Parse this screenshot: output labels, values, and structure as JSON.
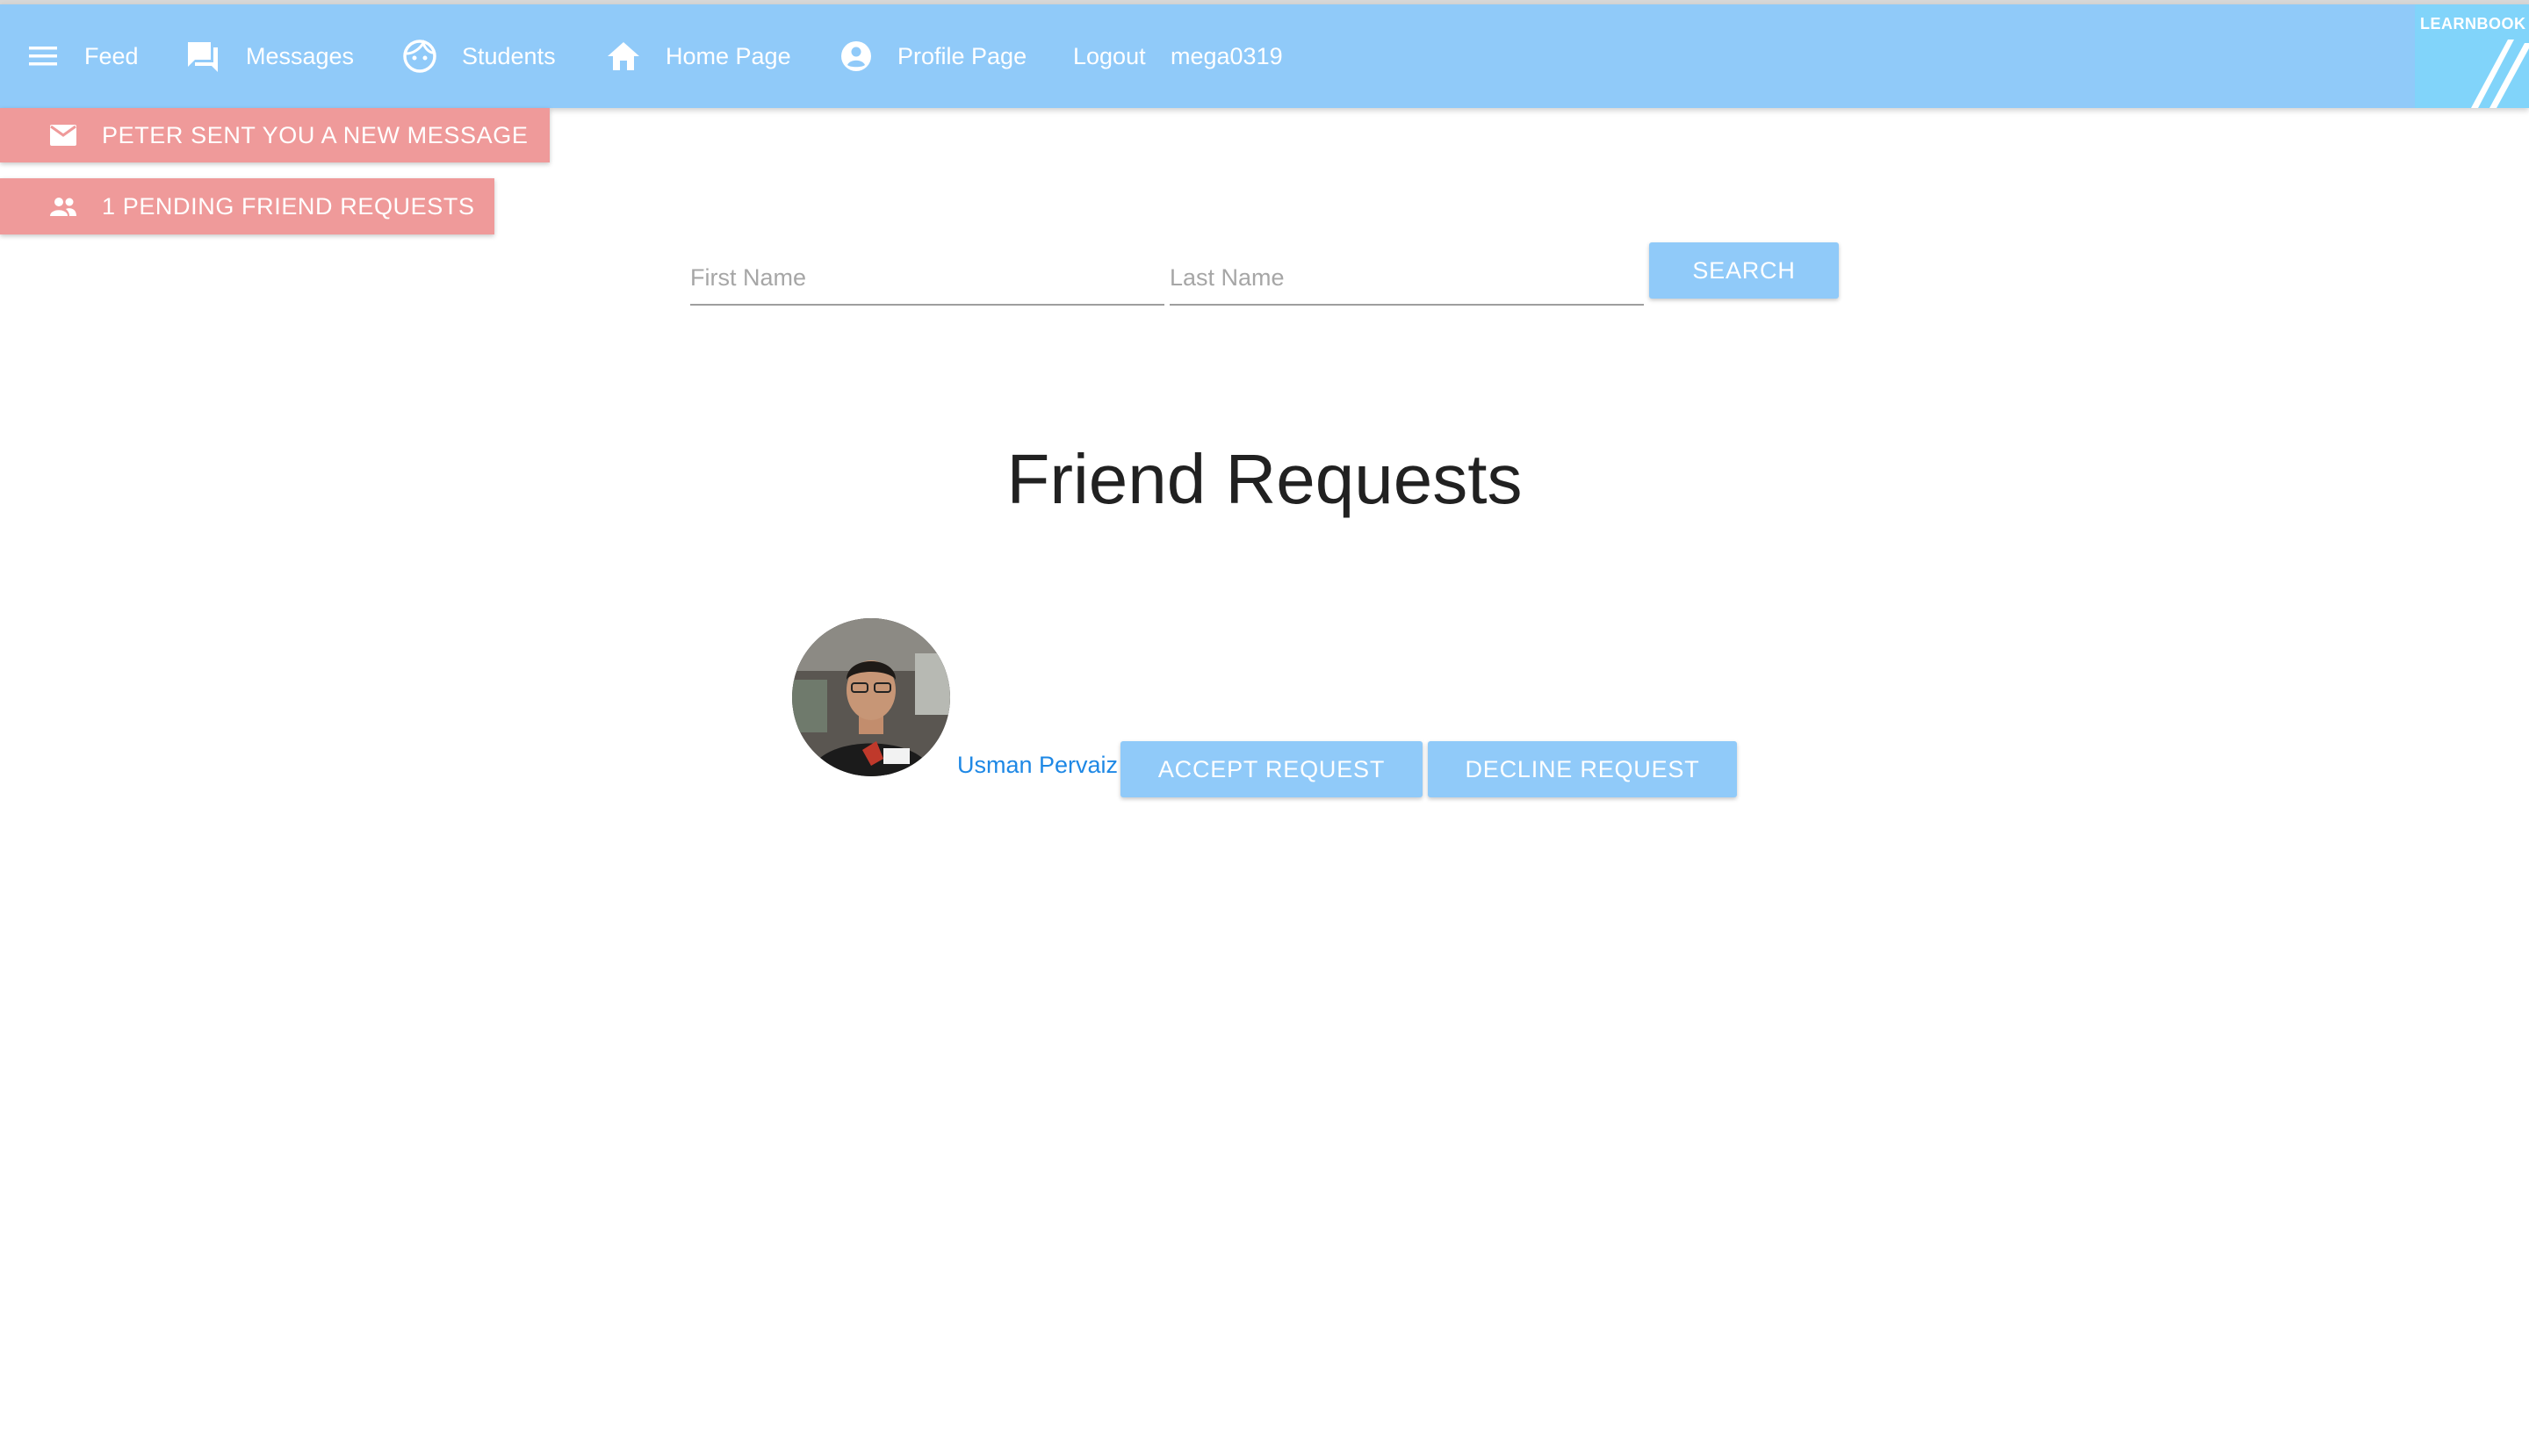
{
  "nav": {
    "feed": "Feed",
    "messages": "Messages",
    "students": "Students",
    "home": "Home Page",
    "profile": "Profile Page",
    "logout": "Logout",
    "username": "mega0319",
    "brand": "LEARNBOOK"
  },
  "notifications": {
    "message": "PETER SENT YOU A NEW MESSAGE",
    "friend_requests": "1 PENDING FRIEND REQUESTS"
  },
  "search": {
    "first_name_placeholder": "First Name",
    "last_name_placeholder": "Last Name",
    "button": "SEARCH"
  },
  "friend_requests": {
    "title": "Friend Requests",
    "items": [
      {
        "name": "Usman Pervaiz",
        "accept": "ACCEPT REQUEST",
        "decline": "DECLINE REQUEST"
      }
    ]
  },
  "colors": {
    "navbar": "#90caf9",
    "brand": "#81d4fa",
    "notification": "#ef9a9a",
    "button": "#90caf9",
    "link": "#1e88e5"
  }
}
